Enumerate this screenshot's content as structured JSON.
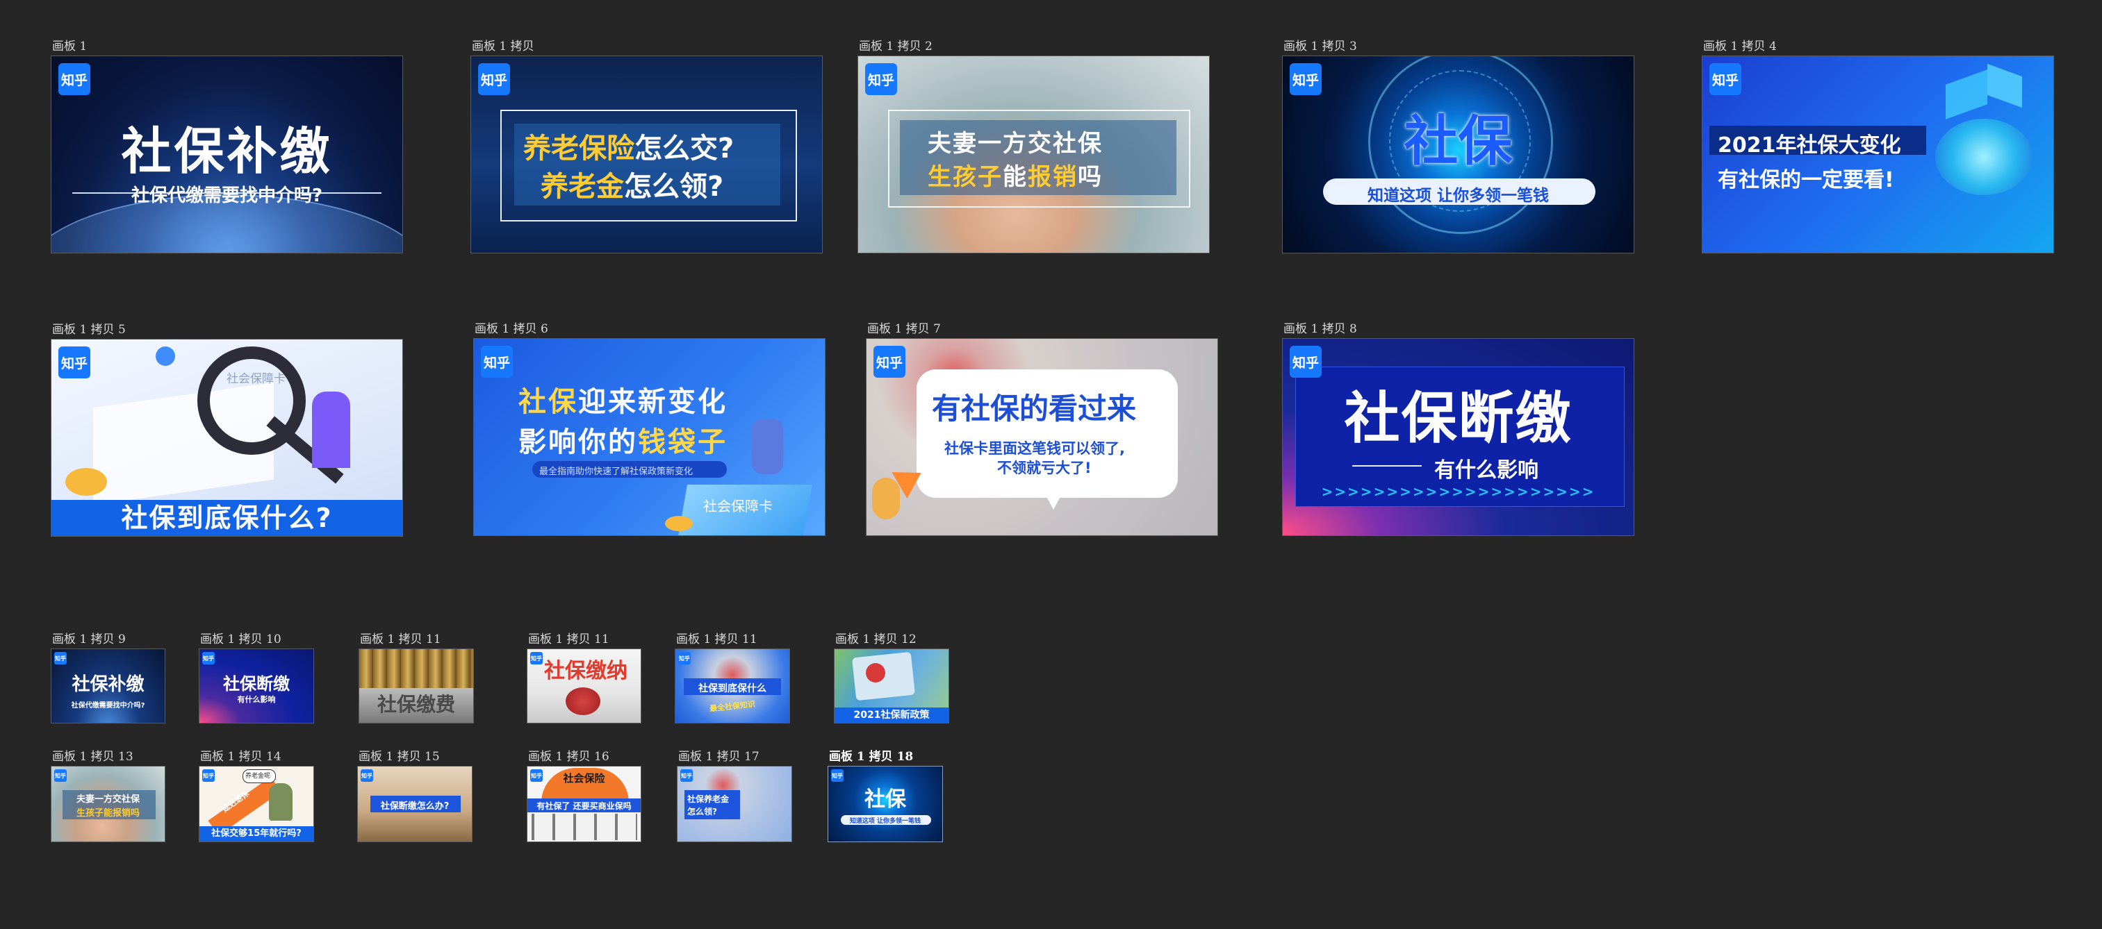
{
  "logo_text": "知乎",
  "boards": {
    "b0": {
      "name": "画板 1",
      "title": "社保补缴",
      "subtitle": "社保代缴需要找中介吗?"
    },
    "b1": {
      "name": "画板 1 拷贝",
      "line1a": "养老保险",
      "line1b": "怎么交?",
      "line2a": "养老金",
      "line2b": "怎么领?"
    },
    "b2": {
      "name": "画板 1 拷贝 2",
      "line1": "夫妻一方交社保",
      "line2a": "生孩子",
      "line2b": "能",
      "line2c": "报销",
      "line2d": "吗"
    },
    "b3": {
      "name": "画板 1 拷贝 3",
      "title": "社保",
      "pill": "知道这项 让你多领一笔钱"
    },
    "b4": {
      "name": "画板 1 拷贝 4",
      "line1": "2021年社保大变化",
      "line2": "有社保的一定要看!"
    },
    "b5": {
      "name": "画板 1 拷贝 5",
      "card": "社会保障卡",
      "band": "社保到底保什么?"
    },
    "b6": {
      "name": "画板 1 拷贝 6",
      "line1a": "社保",
      "line1b": "迎来新变化",
      "line2a": "影响你的",
      "line2b": "钱袋子",
      "pill": "最全指南助你快速了解社保政策新变化",
      "card": "社会保障卡"
    },
    "b7": {
      "name": "画板 1 拷贝 7",
      "title": "有社保的看过来",
      "line1": "社保卡里面这笔钱可以领了,",
      "line2": "不领就亏大了!"
    },
    "b8": {
      "name": "画板 1 拷贝 8",
      "title": "社保断缴",
      "subtitle": "有什么影响",
      "arrows": ">>>>>>>>>>>>>>>>>>>>>"
    },
    "b9": {
      "name": "画板 1 拷贝 9",
      "title": "社保补缴",
      "subtitle": "社保代缴需要找中介吗?"
    },
    "b10": {
      "name": "画板 1 拷贝 10",
      "title": "社保断缴",
      "subtitle": "有什么影响"
    },
    "b11a": {
      "name": "画板 1 拷贝 11",
      "title": "社保缴费"
    },
    "b11b": {
      "name": "画板 1 拷贝 11",
      "title": "社保缴纳"
    },
    "b11c": {
      "name": "画板 1 拷贝 11",
      "title": "社保到底保什么",
      "sub": "最全社保知识"
    },
    "b12": {
      "name": "画板 1 拷贝 12",
      "band": "2021社保新政策"
    },
    "b13": {
      "name": "画板 1 拷贝 13",
      "line1": "夫妻一方交社保",
      "line2": "生孩子能报销吗"
    },
    "b14": {
      "name": "画板 1 拷贝 14",
      "bubble": "养老金呢",
      "arrow": "延迟退休",
      "band": "社保交够15年就行吗?"
    },
    "b15": {
      "name": "画板 1 拷贝 15",
      "title": "社保断缴怎么办?"
    },
    "b16": {
      "name": "画板 1 拷贝 16",
      "umbrella": "社会保险",
      "band": "有社保了 还要买商业保吗"
    },
    "b17": {
      "name": "画板 1 拷贝 17",
      "line1": "社保养老金",
      "line2": "怎么领?"
    },
    "b18": {
      "name": "画板 1 拷贝 18",
      "title": "社保",
      "pill": "知道这项 让你多领一笔钱"
    }
  }
}
